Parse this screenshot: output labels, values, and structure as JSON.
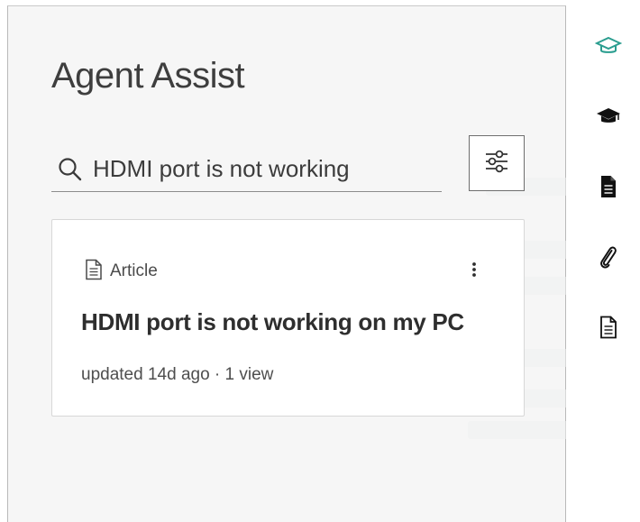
{
  "app": {
    "title": "Agent Assist"
  },
  "search": {
    "value": "HDMI port is not working",
    "placeholder": ""
  },
  "filter_button": {
    "icon": "sliders-icon"
  },
  "results": [
    {
      "type_label": "Article",
      "type_icon": "document-icon",
      "title": "HDMI port is not working on my PC",
      "meta": "updated 14d ago · 1 view",
      "more_icon": "more-vertical-icon"
    }
  ],
  "rail": {
    "items": [
      {
        "icon": "graduation-cap-outline-icon",
        "color": "#2a9d8f"
      },
      {
        "icon": "graduation-cap-icon",
        "color": "#111111"
      },
      {
        "icon": "document-filled-icon",
        "color": "#111111"
      },
      {
        "icon": "paperclip-icon",
        "color": "#111111"
      },
      {
        "icon": "document-outline-icon",
        "color": "#111111"
      }
    ]
  },
  "colors": {
    "panel_bg": "#f6f6f6",
    "accent": "#2a9d8f",
    "text": "#3e3e3e"
  }
}
